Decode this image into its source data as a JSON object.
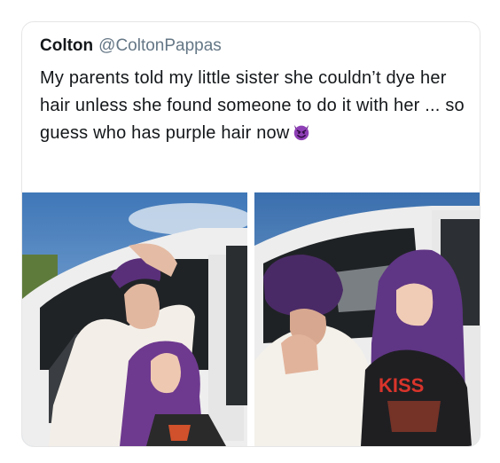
{
  "tweet": {
    "author_name": "Colton",
    "author_handle": "@ColtonPappas",
    "text": "My parents told my little sister she couldn’t dye her hair unless she found someone to do it with her ... so guess who has purple hair now",
    "emoji": "smiling-devil-emoji"
  },
  "photos": [
    {
      "name": "photo-left"
    },
    {
      "name": "photo-right"
    }
  ]
}
